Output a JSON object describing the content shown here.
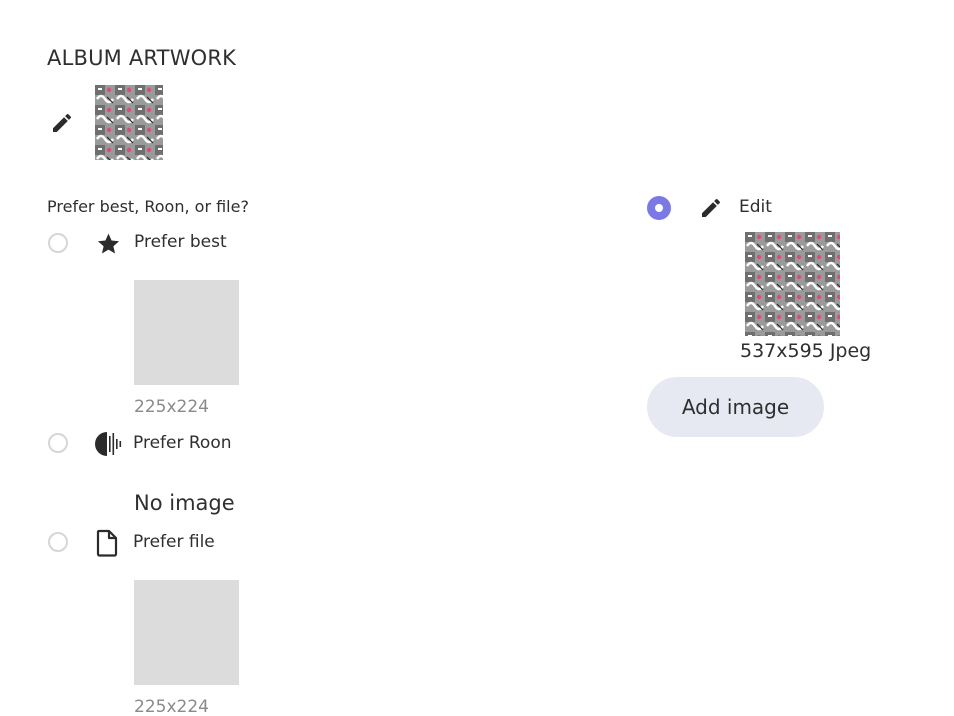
{
  "section": {
    "title": "ALBUM ARTWORK"
  },
  "question": "Prefer best, Roon, or file?",
  "options": [
    {
      "label": "Prefer best",
      "icon": "star-icon",
      "dimensions": "225x224",
      "selected": false
    },
    {
      "label": "Prefer Roon",
      "icon": "roon-icon",
      "no_image": "No image",
      "selected": false
    },
    {
      "label": "Prefer file",
      "icon": "file-icon",
      "dimensions": "225x224",
      "selected": false
    }
  ],
  "custom": {
    "label": "Edit",
    "icon": "pencil-icon",
    "selected": true,
    "resolution": "537x595 Jpeg",
    "add_label": "Add image"
  },
  "colors": {
    "accent": "#7b79e6",
    "button_bg": "#e6e9f1",
    "placeholder": "#dcdcdc"
  }
}
